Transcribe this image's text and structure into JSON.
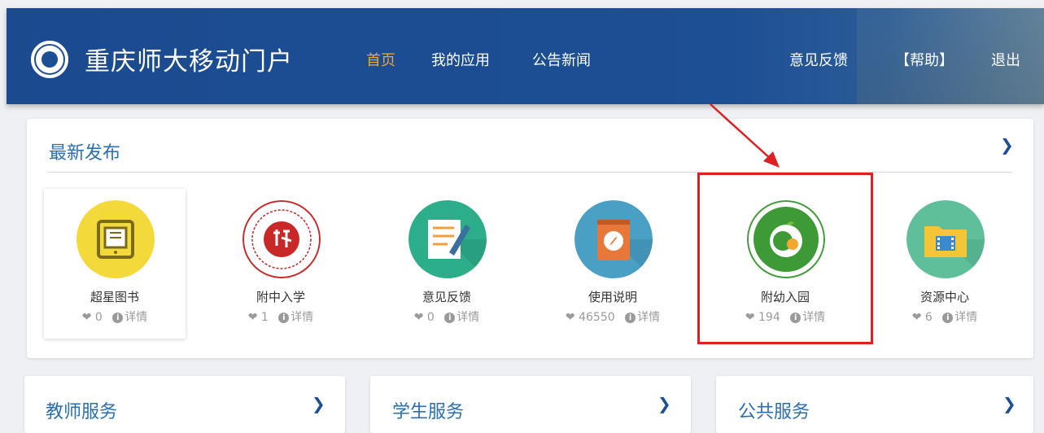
{
  "header": {
    "title": "重庆师大移动门户",
    "nav": [
      "首页",
      "我的应用",
      "公告新闻"
    ],
    "right_nav": [
      "意见反馈",
      "【帮助】",
      "退出"
    ]
  },
  "latest": {
    "title": "最新发布",
    "apps": [
      {
        "name": "超星图书",
        "likes": "0",
        "detail": "详情"
      },
      {
        "name": "附中入学",
        "likes": "1",
        "detail": "详情"
      },
      {
        "name": "意见反馈",
        "likes": "0",
        "detail": "详情"
      },
      {
        "name": "使用说明",
        "likes": "46550",
        "detail": "详情"
      },
      {
        "name": "附幼入园",
        "likes": "194",
        "detail": "详情"
      },
      {
        "name": "资源中心",
        "likes": "6",
        "detail": "详情"
      }
    ]
  },
  "services": [
    "教师服务",
    "学生服务",
    "公共服务"
  ],
  "colors": {
    "header": "#1d4f95",
    "accent": "#f3a630",
    "highlight": "#e02020",
    "section_title": "#2a6fb2"
  }
}
